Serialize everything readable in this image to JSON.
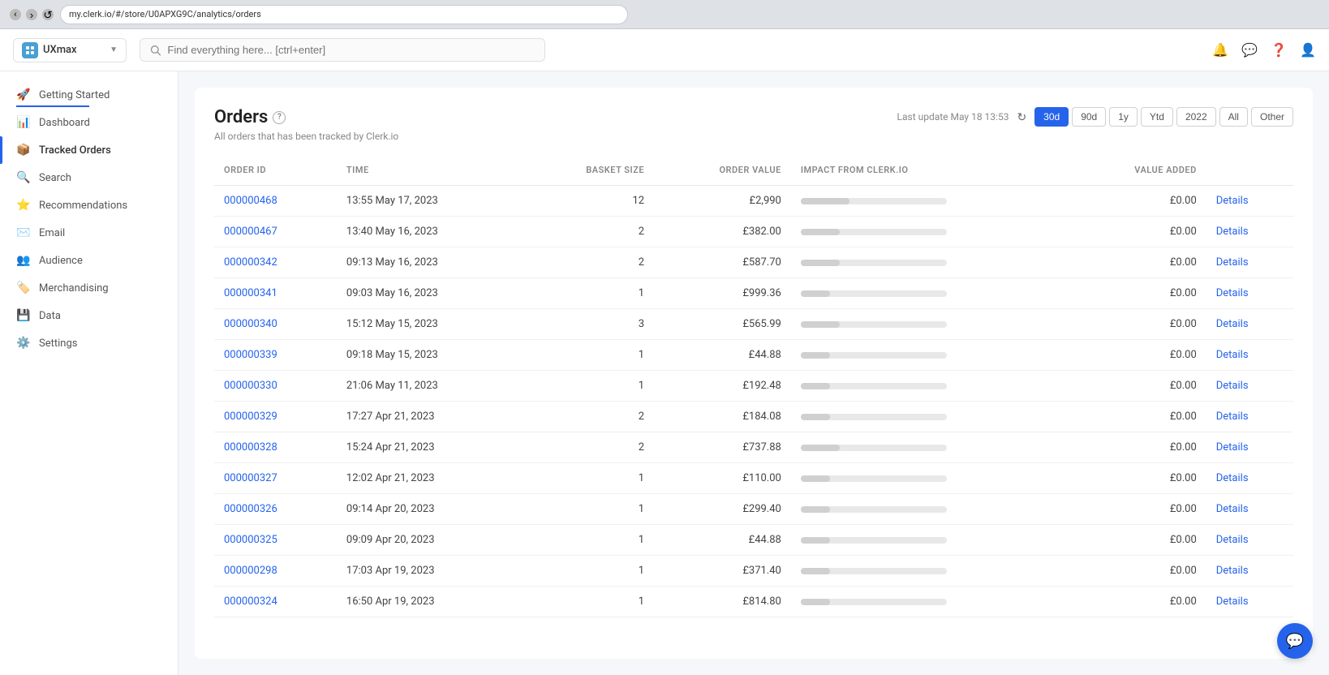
{
  "browser": {
    "url": "my.clerk.io/#/store/U0APXG9C/analytics/orders"
  },
  "header": {
    "store_name": "UXmax",
    "search_placeholder": "Find everything here... [ctrl+enter]"
  },
  "sidebar": {
    "items": [
      {
        "id": "getting-started",
        "label": "Getting Started",
        "active": false,
        "underline": true
      },
      {
        "id": "dashboard",
        "label": "Dashboard",
        "active": false
      },
      {
        "id": "tracked-orders",
        "label": "Tracked Orders",
        "active": true
      },
      {
        "id": "search",
        "label": "Search",
        "active": false
      },
      {
        "id": "recommendations",
        "label": "Recommendations",
        "active": false
      },
      {
        "id": "email",
        "label": "Email",
        "active": false
      },
      {
        "id": "audience",
        "label": "Audience",
        "active": false
      },
      {
        "id": "merchandising",
        "label": "Merchandising",
        "active": false
      },
      {
        "id": "data",
        "label": "Data",
        "active": false
      },
      {
        "id": "settings",
        "label": "Settings",
        "active": false
      }
    ]
  },
  "orders": {
    "title": "Orders",
    "subtitle": "All orders that has been tracked by Clerk.io",
    "last_update": "Last update May 18 13:53",
    "time_filters": [
      "30d",
      "90d",
      "1y",
      "Ytd",
      "2022",
      "All",
      "Other"
    ],
    "active_filter": "30d",
    "table": {
      "columns": [
        "ORDER ID",
        "TIME",
        "BASKET SIZE",
        "ORDER VALUE",
        "IMPACT FROM CLERK.IO",
        "VALUE ADDED",
        ""
      ],
      "rows": [
        {
          "id": "000000468",
          "time": "13:55 May 17, 2023",
          "basket": "12",
          "value": "£2,990",
          "impact": 5,
          "value_added": "£0.00"
        },
        {
          "id": "000000467",
          "time": "13:40 May 16, 2023",
          "basket": "2",
          "value": "£382.00",
          "impact": 4,
          "value_added": "£0.00"
        },
        {
          "id": "000000342",
          "time": "09:13 May 16, 2023",
          "basket": "2",
          "value": "£587.70",
          "impact": 4,
          "value_added": "£0.00"
        },
        {
          "id": "000000341",
          "time": "09:03 May 16, 2023",
          "basket": "1",
          "value": "£999.36",
          "impact": 3,
          "value_added": "£0.00"
        },
        {
          "id": "000000340",
          "time": "15:12 May 15, 2023",
          "basket": "3",
          "value": "£565.99",
          "impact": 4,
          "value_added": "£0.00"
        },
        {
          "id": "000000339",
          "time": "09:18 May 15, 2023",
          "basket": "1",
          "value": "£44.88",
          "impact": 3,
          "value_added": "£0.00"
        },
        {
          "id": "000000330",
          "time": "21:06 May 11, 2023",
          "basket": "1",
          "value": "£192.48",
          "impact": 3,
          "value_added": "£0.00"
        },
        {
          "id": "000000329",
          "time": "17:27 Apr 21, 2023",
          "basket": "2",
          "value": "£184.08",
          "impact": 3,
          "value_added": "£0.00"
        },
        {
          "id": "000000328",
          "time": "15:24 Apr 21, 2023",
          "basket": "2",
          "value": "£737.88",
          "impact": 4,
          "value_added": "£0.00"
        },
        {
          "id": "000000327",
          "time": "12:02 Apr 21, 2023",
          "basket": "1",
          "value": "£110.00",
          "impact": 3,
          "value_added": "£0.00"
        },
        {
          "id": "000000326",
          "time": "09:14 Apr 20, 2023",
          "basket": "1",
          "value": "£299.40",
          "impact": 3,
          "value_added": "£0.00"
        },
        {
          "id": "000000325",
          "time": "09:09 Apr 20, 2023",
          "basket": "1",
          "value": "£44.88",
          "impact": 3,
          "value_added": "£0.00"
        },
        {
          "id": "000000298",
          "time": "17:03 Apr 19, 2023",
          "basket": "1",
          "value": "£371.40",
          "impact": 3,
          "value_added": "£0.00"
        },
        {
          "id": "000000324",
          "time": "16:50 Apr 19, 2023",
          "basket": "1",
          "value": "£814.80",
          "impact": 3,
          "value_added": "£0.00"
        }
      ],
      "details_label": "Details"
    }
  }
}
